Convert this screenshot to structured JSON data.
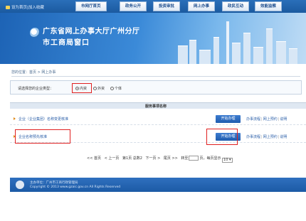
{
  "topnav": {
    "home": "设为首页|加入收藏",
    "items": [
      "市网厅首页",
      "政务公开",
      "投资审批",
      "网上办事",
      "政民互动",
      "效能监察"
    ]
  },
  "banner": {
    "title_line1": "广东省网上办事大厅广州分厅",
    "title_line2": "市工商局窗口"
  },
  "breadcrumb": "您的位置：首页 > 网上办事",
  "enterprise_type": {
    "label": "请选择您的企业类型：",
    "options": [
      "内资",
      "外资",
      "个体"
    ],
    "selected": "内资"
  },
  "table": {
    "header": "服务事项名称",
    "rows": [
      {
        "name": "企业（企业集团）名称变更核准",
        "button": "开始办理",
        "links": [
          "办事流程",
          "网上预约",
          "说明"
        ]
      },
      {
        "name": "企业名称预先核准",
        "button": "开始办理",
        "links": [
          "办事流程",
          "网上预约",
          "说明"
        ]
      }
    ]
  },
  "pager": {
    "first": "<< 首页",
    "prev": "< 上一页",
    "next": "下一页 >",
    "last": "尾页 >>",
    "info": "第1页 总数2",
    "goto_label": "转至",
    "page_unit": "页，每页显示",
    "page_size": "10"
  },
  "footer": {
    "line1": "主办单位：广州市工商行政管理局",
    "line2": "Copyright © 2013 www.gzaic.gov.cn All Rights Reserved"
  },
  "colors": {
    "nav_blue": "#1b5aa0",
    "button_blue": "#1f5cae",
    "highlight_red": "#e02020"
  }
}
